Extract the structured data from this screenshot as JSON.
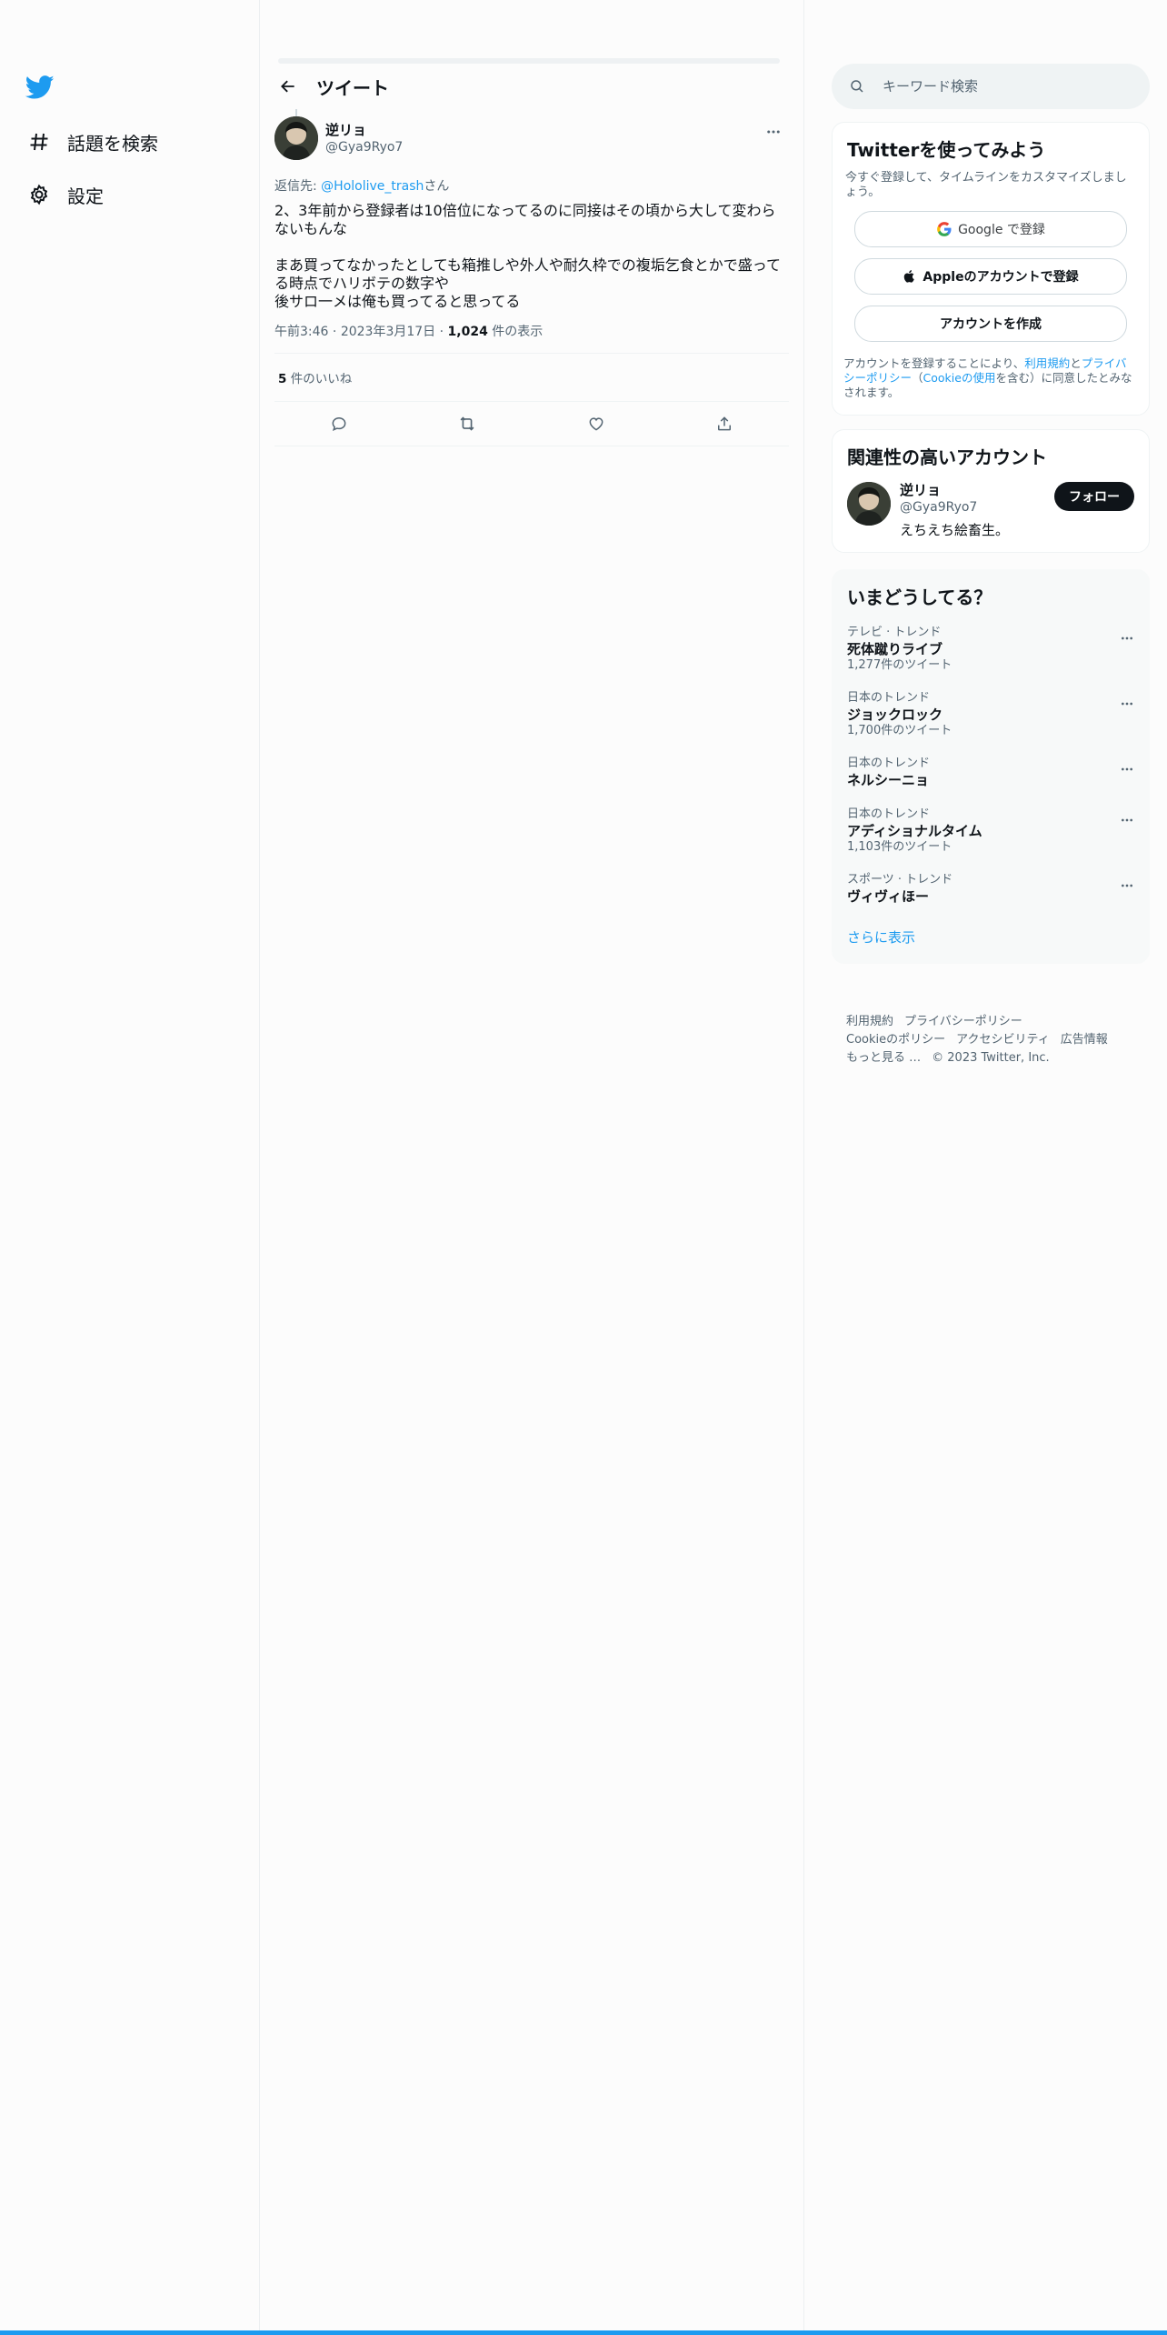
{
  "colors": {
    "accent": "#1d9bf0",
    "text": "#0f1419",
    "secondary": "#536471"
  },
  "nav": {
    "logo": "twitter-bird-icon",
    "items": [
      {
        "label": "話題を検索",
        "icon": "hashtag-icon"
      },
      {
        "label": "設定",
        "icon": "gear-icon"
      }
    ]
  },
  "header": {
    "title": "ツイート"
  },
  "tweet": {
    "author_name": "逆リョ",
    "author_handle": "@Gya9Ryo7",
    "reply_prefix": "返信先: ",
    "reply_mention": "@Hololive_trash",
    "reply_suffix": "さん",
    "text": "2、3年前から登録者は10倍位になってるのに同接はその頃から大して変わらないもんな\n\nまあ買ってなかったとしても箱推しや外人や耐久枠での複垢乞食とかで盛ってる時点でハリボテの数字や\n後サロ一メは俺も買ってると思ってる",
    "time": "午前3:46",
    "date": "2023年3月17日",
    "views_count": "1,024",
    "views_label": " 件の表示",
    "likes_count": "5",
    "likes_label": " 件のいいね"
  },
  "search": {
    "placeholder": "キーワード検索"
  },
  "signup": {
    "title": "Twitterを使ってみよう",
    "subtitle": "今すぐ登録して、タイムラインをカスタマイズしましょう。",
    "google": "Google で登録",
    "apple": "Appleのアカウントで登録",
    "create": "アカウントを作成",
    "legal_1": "アカウントを登録することにより、",
    "legal_terms": "利用規約",
    "legal_2": "と",
    "legal_privacy": "プライバシーポリシー",
    "legal_3": "（",
    "legal_cookie": "Cookieの使用",
    "legal_4": "を含む）に同意したとみなされます。"
  },
  "who": {
    "title": "関連性の高いアカウント",
    "name": "逆リョ",
    "handle": "@Gya9Ryo7",
    "bio": "えちえち絵畜生。",
    "follow": "フォロー"
  },
  "trends": {
    "title": "いまどうしてる？",
    "items": [
      {
        "category": "テレビ · トレンド",
        "name": "死体蹴りライブ",
        "count": "1,277件のツイート"
      },
      {
        "category": "日本のトレンド",
        "name": "ジョックロック",
        "count": "1,700件のツイート"
      },
      {
        "category": "日本のトレンド",
        "name": "ネルシーニョ",
        "count": ""
      },
      {
        "category": "日本のトレンド",
        "name": "アディショナルタイム",
        "count": "1,103件のツイート"
      },
      {
        "category": "スポーツ · トレンド",
        "name": "ヴィヴィほー",
        "count": ""
      }
    ],
    "show_more": "さらに表示"
  },
  "footer": {
    "terms": "利用規約",
    "privacy": "プライバシーポリシー",
    "cookie": "Cookieのポリシー",
    "accessibility": "アクセシビリティ",
    "ads": "広告情報",
    "more": "もっと見る …",
    "copyright": "© 2023 Twitter, Inc."
  }
}
